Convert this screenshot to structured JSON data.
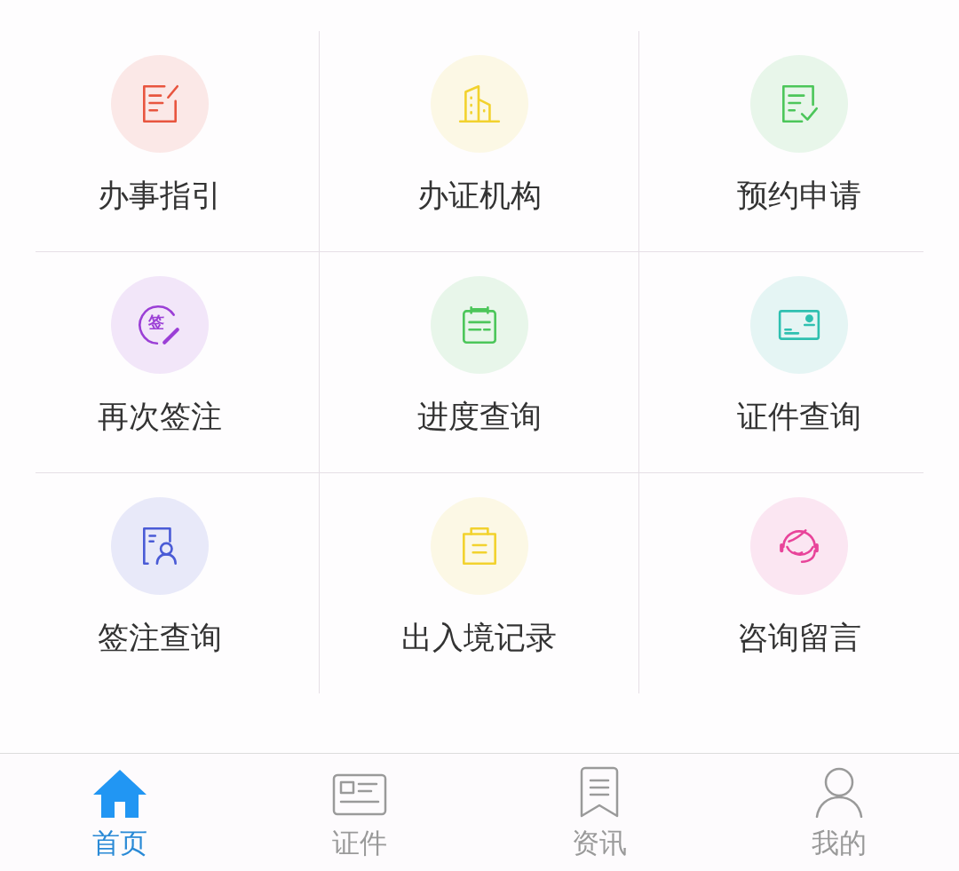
{
  "services": [
    {
      "label": "办事指引",
      "kind": "edit-doc",
      "color": "#e8553f"
    },
    {
      "label": "办证机构",
      "kind": "building",
      "color": "#f2d22e"
    },
    {
      "label": "预约申请",
      "kind": "doc-check",
      "color": "#4cc65a"
    },
    {
      "label": "再次签注",
      "kind": "glyph-pen",
      "glyph": "签",
      "color": "#9b3fd6"
    },
    {
      "label": "进度查询",
      "kind": "calendar",
      "color": "#4cc65a"
    },
    {
      "label": "证件查询",
      "kind": "id-card",
      "color": "#2fc0b0"
    },
    {
      "label": "签注查询",
      "kind": "doc-person",
      "color": "#4a5bd6"
    },
    {
      "label": "出入境记录",
      "kind": "folder",
      "color": "#f2d22e"
    },
    {
      "label": "咨询留言",
      "kind": "headset",
      "color": "#e8449a"
    }
  ],
  "tab_bar": [
    {
      "label": "首页",
      "kind": "home",
      "selected": true
    },
    {
      "label": "证件",
      "kind": "card",
      "selected": false
    },
    {
      "label": "资讯",
      "kind": "bookmark",
      "selected": false
    },
    {
      "label": "我的",
      "kind": "person",
      "selected": false
    }
  ]
}
